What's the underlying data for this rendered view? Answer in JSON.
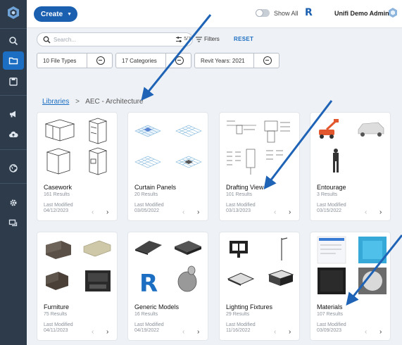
{
  "topbar": {
    "create_label": "Create",
    "show_all_label": "Show All",
    "user_name": "Unifi Demo Admin",
    "revit_logo": "R"
  },
  "search": {
    "placeholder": "Search...",
    "count": "5/7",
    "filters_label": "Filters",
    "reset_label": "RESET"
  },
  "chips": [
    {
      "label": "10 File Types"
    },
    {
      "label": "17 Categories"
    },
    {
      "label": "Revit Years: 2021"
    }
  ],
  "breadcrumb": {
    "link": "Libraries",
    "separator": ">",
    "current": "AEC - Architecture"
  },
  "cards": [
    {
      "title": "Casework",
      "results": "161 Results",
      "last_modified_label": "Last Modified",
      "date": "04/12/2023"
    },
    {
      "title": "Curtain Panels",
      "results": "20 Results",
      "last_modified_label": "Last Modified",
      "date": "03/05/2022"
    },
    {
      "title": "Drafting View",
      "results": "101 Results",
      "last_modified_label": "Last Modified",
      "date": "03/13/2023"
    },
    {
      "title": "Entourage",
      "results": "3 Results",
      "last_modified_label": "Last Modified",
      "date": "03/15/2022"
    },
    {
      "title": "Furniture",
      "results": "75 Results",
      "last_modified_label": "Last Modified",
      "date": "04/11/2023"
    },
    {
      "title": "Generic Models",
      "results": "16 Results",
      "last_modified_label": "Last Modified",
      "date": "04/19/2022"
    },
    {
      "title": "Lighting Fixtures",
      "results": "29 Results",
      "last_modified_label": "Last Modified",
      "date": "11/16/2022"
    },
    {
      "title": "Materials",
      "results": "107 Results",
      "last_modified_label": "Last Modified",
      "date": "03/09/2023"
    }
  ],
  "nav_glyphs": {
    "prev": "‹",
    "next": "›"
  },
  "sidebar": {
    "items": [
      {
        "icon": "search-icon"
      },
      {
        "icon": "folder-icon"
      },
      {
        "icon": "save-icon"
      },
      {
        "icon": "megaphone-icon"
      },
      {
        "icon": "cloud-upload-icon"
      },
      {
        "icon": "globe-icon"
      },
      {
        "icon": "gear-icon"
      },
      {
        "icon": "chat-icon"
      }
    ]
  },
  "colors": {
    "accent": "#1b6ec2",
    "sidebar": "#2d3b4b",
    "create": "#1b5fb0",
    "annotation_arrow": "#1e63b5"
  }
}
